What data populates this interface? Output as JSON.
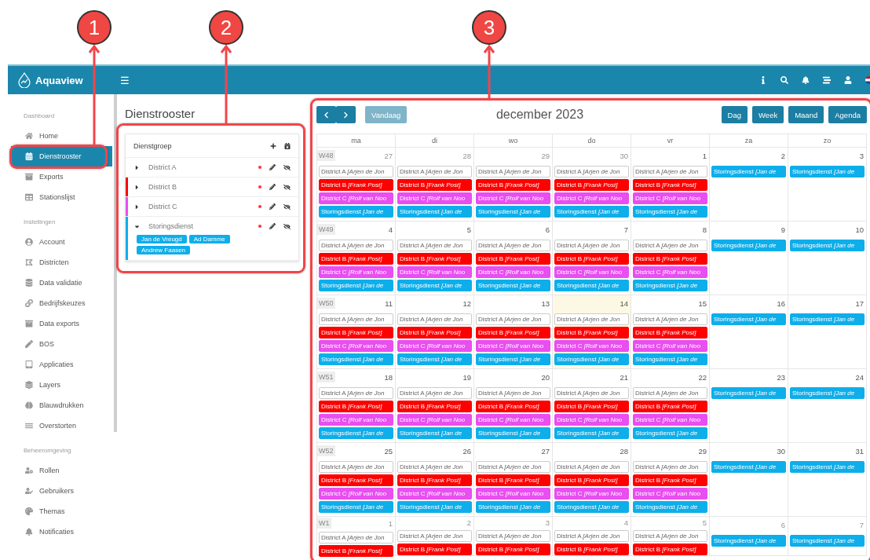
{
  "callouts": [
    {
      "number": "1"
    },
    {
      "number": "2"
    },
    {
      "number": "3"
    }
  ],
  "header": {
    "logo": "Aquaview",
    "menu_icon": "☰"
  },
  "sidebar": {
    "sections": [
      {
        "title": "Dashboard",
        "items": [
          {
            "label": "Home",
            "selected": false
          },
          {
            "label": "Dienstrooster",
            "selected": true
          },
          {
            "label": "Exports",
            "selected": false
          },
          {
            "label": "Stationslijst",
            "selected": false
          }
        ]
      },
      {
        "title": "Instellingen",
        "items": [
          {
            "label": "Account",
            "selected": false
          },
          {
            "label": "Districten",
            "selected": false
          },
          {
            "label": "Data validatie",
            "selected": false
          },
          {
            "label": "Bedrijfskeuzes",
            "selected": false
          },
          {
            "label": "Data exports",
            "selected": false
          },
          {
            "label": "BOS",
            "selected": false
          },
          {
            "label": "Applicaties",
            "selected": false
          },
          {
            "label": "Layers",
            "selected": false
          },
          {
            "label": "Blauwdrukken",
            "selected": false
          },
          {
            "label": "Overstorten",
            "selected": false
          }
        ]
      },
      {
        "title": "Beheeromgeving",
        "items": [
          {
            "label": "Rollen",
            "selected": false
          },
          {
            "label": "Gebruikers",
            "selected": false
          },
          {
            "label": "Themas",
            "selected": false
          },
          {
            "label": "Notificaties",
            "selected": false
          }
        ]
      }
    ]
  },
  "page_title": "Dienstrooster",
  "duty_groups": {
    "title": "Dienstgroep",
    "groups": [
      {
        "name": "District A",
        "color": "#ffffff",
        "expanded": false
      },
      {
        "name": "District B",
        "color": "#ff0000",
        "expanded": false
      },
      {
        "name": "District C",
        "color": "#e84ef0",
        "expanded": false
      },
      {
        "name": "Storingsdienst",
        "color": "#0eaeea",
        "expanded": true,
        "members": [
          "Jan de Vreugd",
          "Ad Damme",
          "Andrew Faasen"
        ]
      }
    ]
  },
  "calendar": {
    "title": "december 2023",
    "today_button": {
      "label": "Vandaag",
      "disabled": true
    },
    "views": [
      "Dag",
      "Week",
      "Maand",
      "Agenda"
    ],
    "weekdays": [
      "ma",
      "di",
      "wo",
      "do",
      "vr",
      "za",
      "zo"
    ],
    "weeks": [
      {
        "label": "W48",
        "days": [
          {
            "number": "27",
            "muted": true,
            "today": false,
            "events": [
              {
                "label": "District A",
                "detail": "[Arjen de Jon",
                "color": "#ffffff"
              },
              {
                "label": "District B",
                "detail": "[Frank Post]",
                "color": "#ff0000"
              },
              {
                "label": "District C",
                "detail": "[Rolf van Noo",
                "color": "#e84ef0"
              },
              {
                "label": "Storingsdienst",
                "detail": "[Jan de",
                "color": "#0eaeea"
              }
            ]
          },
          {
            "number": "28",
            "muted": true,
            "today": false,
            "events": [
              {
                "label": "District A",
                "detail": "[Arjen de Jon",
                "color": "#ffffff"
              },
              {
                "label": "District B",
                "detail": "[Frank Post]",
                "color": "#ff0000"
              },
              {
                "label": "District C",
                "detail": "[Rolf van Noo",
                "color": "#e84ef0"
              },
              {
                "label": "Storingsdienst",
                "detail": "[Jan de",
                "color": "#0eaeea"
              }
            ]
          },
          {
            "number": "29",
            "muted": true,
            "today": false,
            "events": [
              {
                "label": "District A",
                "detail": "[Arjen de Jon",
                "color": "#ffffff"
              },
              {
                "label": "District B",
                "detail": "[Frank Post]",
                "color": "#ff0000"
              },
              {
                "label": "District C",
                "detail": "[Rolf van Noo",
                "color": "#e84ef0"
              },
              {
                "label": "Storingsdienst",
                "detail": "[Jan de",
                "color": "#0eaeea"
              }
            ]
          },
          {
            "number": "30",
            "muted": true,
            "today": false,
            "events": [
              {
                "label": "District A",
                "detail": "[Arjen de Jon",
                "color": "#ffffff"
              },
              {
                "label": "District B",
                "detail": "[Frank Post]",
                "color": "#ff0000"
              },
              {
                "label": "District C",
                "detail": "[Rolf van Noo",
                "color": "#e84ef0"
              },
              {
                "label": "Storingsdienst",
                "detail": "[Jan de",
                "color": "#0eaeea"
              }
            ]
          },
          {
            "number": "1",
            "muted": false,
            "today": false,
            "events": [
              {
                "label": "District A",
                "detail": "[Arjen de Jon",
                "color": "#ffffff"
              },
              {
                "label": "District B",
                "detail": "[Frank Post]",
                "color": "#ff0000"
              },
              {
                "label": "District C",
                "detail": "[Rolf van Noo",
                "color": "#e84ef0"
              },
              {
                "label": "Storingsdienst",
                "detail": "[Jan de",
                "color": "#0eaeea"
              }
            ]
          },
          {
            "number": "2",
            "muted": false,
            "today": false,
            "events": [
              {
                "label": "Storingsdienst",
                "detail": "[Jan de",
                "color": "#0eaeea"
              }
            ]
          },
          {
            "number": "3",
            "muted": false,
            "today": false,
            "events": [
              {
                "label": "Storingsdienst",
                "detail": "[Jan de",
                "color": "#0eaeea"
              }
            ]
          }
        ]
      },
      {
        "label": "W49",
        "days": [
          {
            "number": "4",
            "muted": false,
            "today": false,
            "events": [
              {
                "label": "District A",
                "detail": "[Arjen de Jon",
                "color": "#ffffff"
              },
              {
                "label": "District B",
                "detail": "[Frank Post]",
                "color": "#ff0000"
              },
              {
                "label": "District C",
                "detail": "[Rolf van Noo",
                "color": "#e84ef0"
              },
              {
                "label": "Storingsdienst",
                "detail": "[Jan de",
                "color": "#0eaeea"
              }
            ]
          },
          {
            "number": "5",
            "muted": false,
            "today": false,
            "events": [
              {
                "label": "District A",
                "detail": "[Arjen de Jon",
                "color": "#ffffff"
              },
              {
                "label": "District B",
                "detail": "[Frank Post]",
                "color": "#ff0000"
              },
              {
                "label": "District C",
                "detail": "[Rolf van Noo",
                "color": "#e84ef0"
              },
              {
                "label": "Storingsdienst",
                "detail": "[Jan de",
                "color": "#0eaeea"
              }
            ]
          },
          {
            "number": "6",
            "muted": false,
            "today": false,
            "events": [
              {
                "label": "District A",
                "detail": "[Arjen de Jon",
                "color": "#ffffff"
              },
              {
                "label": "District B",
                "detail": "[Frank Post]",
                "color": "#ff0000"
              },
              {
                "label": "District C",
                "detail": "[Rolf van Noo",
                "color": "#e84ef0"
              },
              {
                "label": "Storingsdienst",
                "detail": "[Jan de",
                "color": "#0eaeea"
              }
            ]
          },
          {
            "number": "7",
            "muted": false,
            "today": false,
            "events": [
              {
                "label": "District A",
                "detail": "[Arjen de Jon",
                "color": "#ffffff"
              },
              {
                "label": "District B",
                "detail": "[Frank Post]",
                "color": "#ff0000"
              },
              {
                "label": "District C",
                "detail": "[Rolf van Noo",
                "color": "#e84ef0"
              },
              {
                "label": "Storingsdienst",
                "detail": "[Jan de",
                "color": "#0eaeea"
              }
            ]
          },
          {
            "number": "8",
            "muted": false,
            "today": false,
            "events": [
              {
                "label": "District A",
                "detail": "[Arjen de Jon",
                "color": "#ffffff"
              },
              {
                "label": "District B",
                "detail": "[Frank Post]",
                "color": "#ff0000"
              },
              {
                "label": "District C",
                "detail": "[Rolf van Noo",
                "color": "#e84ef0"
              },
              {
                "label": "Storingsdienst",
                "detail": "[Jan de",
                "color": "#0eaeea"
              }
            ]
          },
          {
            "number": "9",
            "muted": false,
            "today": false,
            "events": [
              {
                "label": "Storingsdienst",
                "detail": "[Jan de",
                "color": "#0eaeea"
              }
            ]
          },
          {
            "number": "10",
            "muted": false,
            "today": false,
            "events": [
              {
                "label": "Storingsdienst",
                "detail": "[Jan de",
                "color": "#0eaeea"
              }
            ]
          }
        ]
      },
      {
        "label": "W50",
        "days": [
          {
            "number": "11",
            "muted": false,
            "today": false,
            "events": [
              {
                "label": "District A",
                "detail": "[Arjen de Jon",
                "color": "#ffffff"
              },
              {
                "label": "District B",
                "detail": "[Frank Post]",
                "color": "#ff0000"
              },
              {
                "label": "District C",
                "detail": "[Rolf van Noo",
                "color": "#e84ef0"
              },
              {
                "label": "Storingsdienst",
                "detail": "[Jan de",
                "color": "#0eaeea"
              }
            ]
          },
          {
            "number": "12",
            "muted": false,
            "today": false,
            "events": [
              {
                "label": "District A",
                "detail": "[Arjen de Jon",
                "color": "#ffffff"
              },
              {
                "label": "District B",
                "detail": "[Frank Post]",
                "color": "#ff0000"
              },
              {
                "label": "District C",
                "detail": "[Rolf van Noo",
                "color": "#e84ef0"
              },
              {
                "label": "Storingsdienst",
                "detail": "[Jan de",
                "color": "#0eaeea"
              }
            ]
          },
          {
            "number": "13",
            "muted": false,
            "today": false,
            "events": [
              {
                "label": "District A",
                "detail": "[Arjen de Jon",
                "color": "#ffffff"
              },
              {
                "label": "District B",
                "detail": "[Frank Post]",
                "color": "#ff0000"
              },
              {
                "label": "District C",
                "detail": "[Rolf van Noo",
                "color": "#e84ef0"
              },
              {
                "label": "Storingsdienst",
                "detail": "[Jan de",
                "color": "#0eaeea"
              }
            ]
          },
          {
            "number": "14",
            "muted": false,
            "today": true,
            "events": [
              {
                "label": "District A",
                "detail": "[Arjen de Jon",
                "color": "#ffffff"
              },
              {
                "label": "District B",
                "detail": "[Frank Post]",
                "color": "#ff0000"
              },
              {
                "label": "District C",
                "detail": "[Rolf van Noo",
                "color": "#e84ef0"
              },
              {
                "label": "Storingsdienst",
                "detail": "[Jan de",
                "color": "#0eaeea"
              }
            ]
          },
          {
            "number": "15",
            "muted": false,
            "today": false,
            "events": [
              {
                "label": "District A",
                "detail": "[Arjen de Jon",
                "color": "#ffffff"
              },
              {
                "label": "District B",
                "detail": "[Frank Post]",
                "color": "#ff0000"
              },
              {
                "label": "District C",
                "detail": "[Rolf van Noo",
                "color": "#e84ef0"
              },
              {
                "label": "Storingsdienst",
                "detail": "[Jan de",
                "color": "#0eaeea"
              }
            ]
          },
          {
            "number": "16",
            "muted": false,
            "today": false,
            "events": [
              {
                "label": "Storingsdienst",
                "detail": "[Jan de",
                "color": "#0eaeea"
              }
            ]
          },
          {
            "number": "17",
            "muted": false,
            "today": false,
            "events": [
              {
                "label": "Storingsdienst",
                "detail": "[Jan de",
                "color": "#0eaeea"
              }
            ]
          }
        ]
      },
      {
        "label": "W51",
        "days": [
          {
            "number": "18",
            "muted": false,
            "today": false,
            "events": [
              {
                "label": "District A",
                "detail": "[Arjen de Jon",
                "color": "#ffffff"
              },
              {
                "label": "District B",
                "detail": "[Frank Post]",
                "color": "#ff0000"
              },
              {
                "label": "District C",
                "detail": "[Rolf van Noo",
                "color": "#e84ef0"
              },
              {
                "label": "Storingsdienst",
                "detail": "[Jan de",
                "color": "#0eaeea"
              }
            ]
          },
          {
            "number": "19",
            "muted": false,
            "today": false,
            "events": [
              {
                "label": "District A",
                "detail": "[Arjen de Jon",
                "color": "#ffffff"
              },
              {
                "label": "District B",
                "detail": "[Frank Post]",
                "color": "#ff0000"
              },
              {
                "label": "District C",
                "detail": "[Rolf van Noo",
                "color": "#e84ef0"
              },
              {
                "label": "Storingsdienst",
                "detail": "[Jan de",
                "color": "#0eaeea"
              }
            ]
          },
          {
            "number": "20",
            "muted": false,
            "today": false,
            "events": [
              {
                "label": "District A",
                "detail": "[Arjen de Jon",
                "color": "#ffffff"
              },
              {
                "label": "District B",
                "detail": "[Frank Post]",
                "color": "#ff0000"
              },
              {
                "label": "District C",
                "detail": "[Rolf van Noo",
                "color": "#e84ef0"
              },
              {
                "label": "Storingsdienst",
                "detail": "[Jan de",
                "color": "#0eaeea"
              }
            ]
          },
          {
            "number": "21",
            "muted": false,
            "today": false,
            "events": [
              {
                "label": "District A",
                "detail": "[Arjen de Jon",
                "color": "#ffffff"
              },
              {
                "label": "District B",
                "detail": "[Frank Post]",
                "color": "#ff0000"
              },
              {
                "label": "District C",
                "detail": "[Rolf van Noo",
                "color": "#e84ef0"
              },
              {
                "label": "Storingsdienst",
                "detail": "[Jan de",
                "color": "#0eaeea"
              }
            ]
          },
          {
            "number": "22",
            "muted": false,
            "today": false,
            "events": [
              {
                "label": "District A",
                "detail": "[Arjen de Jon",
                "color": "#ffffff"
              },
              {
                "label": "District B",
                "detail": "[Frank Post]",
                "color": "#ff0000"
              },
              {
                "label": "District C",
                "detail": "[Rolf van Noo",
                "color": "#e84ef0"
              },
              {
                "label": "Storingsdienst",
                "detail": "[Jan de",
                "color": "#0eaeea"
              }
            ]
          },
          {
            "number": "23",
            "muted": false,
            "today": false,
            "events": [
              {
                "label": "Storingsdienst",
                "detail": "[Jan de",
                "color": "#0eaeea"
              }
            ]
          },
          {
            "number": "24",
            "muted": false,
            "today": false,
            "events": [
              {
                "label": "Storingsdienst",
                "detail": "[Jan de",
                "color": "#0eaeea"
              }
            ]
          }
        ]
      },
      {
        "label": "W52",
        "days": [
          {
            "number": "25",
            "muted": false,
            "today": false,
            "events": [
              {
                "label": "District A",
                "detail": "[Arjen de Jon",
                "color": "#ffffff"
              },
              {
                "label": "District B",
                "detail": "[Frank Post]",
                "color": "#ff0000"
              },
              {
                "label": "District C",
                "detail": "[Rolf van Noo",
                "color": "#e84ef0"
              },
              {
                "label": "Storingsdienst",
                "detail": "[Jan de",
                "color": "#0eaeea"
              }
            ]
          },
          {
            "number": "26",
            "muted": false,
            "today": false,
            "events": [
              {
                "label": "District A",
                "detail": "[Arjen de Jon",
                "color": "#ffffff"
              },
              {
                "label": "District B",
                "detail": "[Frank Post]",
                "color": "#ff0000"
              },
              {
                "label": "District C",
                "detail": "[Rolf van Noo",
                "color": "#e84ef0"
              },
              {
                "label": "Storingsdienst",
                "detail": "[Jan de",
                "color": "#0eaeea"
              }
            ]
          },
          {
            "number": "27",
            "muted": false,
            "today": false,
            "events": [
              {
                "label": "District A",
                "detail": "[Arjen de Jon",
                "color": "#ffffff"
              },
              {
                "label": "District B",
                "detail": "[Frank Post]",
                "color": "#ff0000"
              },
              {
                "label": "District C",
                "detail": "[Rolf van Noo",
                "color": "#e84ef0"
              },
              {
                "label": "Storingsdienst",
                "detail": "[Jan de",
                "color": "#0eaeea"
              }
            ]
          },
          {
            "number": "28",
            "muted": false,
            "today": false,
            "events": [
              {
                "label": "District A",
                "detail": "[Arjen de Jon",
                "color": "#ffffff"
              },
              {
                "label": "District B",
                "detail": "[Frank Post]",
                "color": "#ff0000"
              },
              {
                "label": "District C",
                "detail": "[Rolf van Noo",
                "color": "#e84ef0"
              },
              {
                "label": "Storingsdienst",
                "detail": "[Jan de",
                "color": "#0eaeea"
              }
            ]
          },
          {
            "number": "29",
            "muted": false,
            "today": false,
            "events": [
              {
                "label": "District A",
                "detail": "[Arjen de Jon",
                "color": "#ffffff"
              },
              {
                "label": "District B",
                "detail": "[Frank Post]",
                "color": "#ff0000"
              },
              {
                "label": "District C",
                "detail": "[Rolf van Noo",
                "color": "#e84ef0"
              },
              {
                "label": "Storingsdienst",
                "detail": "[Jan de",
                "color": "#0eaeea"
              }
            ]
          },
          {
            "number": "30",
            "muted": false,
            "today": false,
            "events": [
              {
                "label": "Storingsdienst",
                "detail": "[Jan de",
                "color": "#0eaeea"
              }
            ]
          },
          {
            "number": "31",
            "muted": false,
            "today": false,
            "events": [
              {
                "label": "Storingsdienst",
                "detail": "[Jan de",
                "color": "#0eaeea"
              }
            ]
          }
        ]
      },
      {
        "label": "W1",
        "days": [
          {
            "number": "1",
            "muted": true,
            "today": false,
            "events": [
              {
                "label": "District A",
                "detail": "[Arjen de Jon",
                "color": "#ffffff"
              },
              {
                "label": "District B",
                "detail": "[Frank Post]",
                "color": "#ff0000"
              }
            ]
          },
          {
            "number": "2",
            "muted": true,
            "today": false,
            "events": [
              {
                "label": "District A",
                "detail": "[Arjen de Jon",
                "color": "#ffffff"
              },
              {
                "label": "District B",
                "detail": "[Frank Post]",
                "color": "#ff0000"
              }
            ]
          },
          {
            "number": "3",
            "muted": true,
            "today": false,
            "events": [
              {
                "label": "District A",
                "detail": "[Arjen de Jon",
                "color": "#ffffff"
              },
              {
                "label": "District B",
                "detail": "[Frank Post]",
                "color": "#ff0000"
              }
            ]
          },
          {
            "number": "4",
            "muted": true,
            "today": false,
            "events": [
              {
                "label": "District A",
                "detail": "[Arjen de Jon",
                "color": "#ffffff"
              },
              {
                "label": "District B",
                "detail": "[Frank Post]",
                "color": "#ff0000"
              }
            ]
          },
          {
            "number": "5",
            "muted": true,
            "today": false,
            "events": [
              {
                "label": "District A",
                "detail": "[Arjen de Jon",
                "color": "#ffffff"
              },
              {
                "label": "District B",
                "detail": "[Frank Post]",
                "color": "#ff0000"
              }
            ]
          },
          {
            "number": "6",
            "muted": true,
            "today": false,
            "events": [
              {
                "label": "Storingsdienst",
                "detail": "[Jan de",
                "color": "#0eaeea"
              }
            ]
          },
          {
            "number": "7",
            "muted": true,
            "today": false,
            "events": [
              {
                "label": "Storingsdienst",
                "detail": "[Jan de",
                "color": "#0eaeea"
              }
            ]
          }
        ]
      }
    ]
  }
}
